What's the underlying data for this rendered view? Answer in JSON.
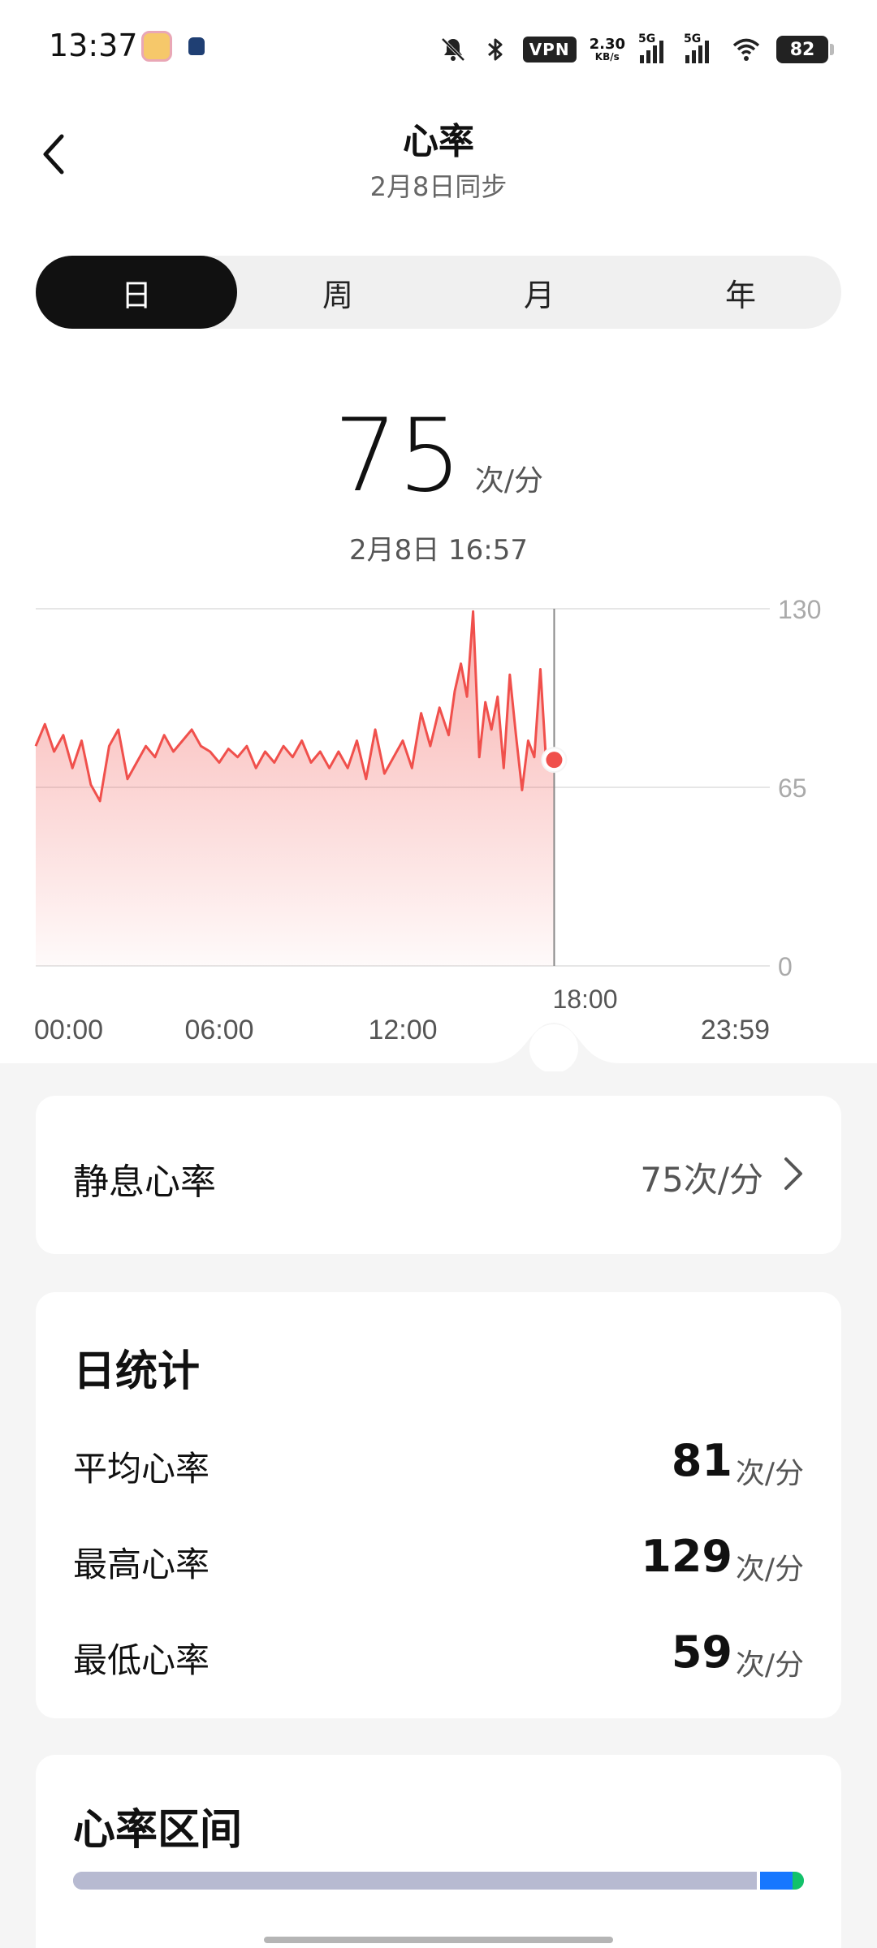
{
  "status_bar": {
    "time": "13:37",
    "net_speed_value": "2.30",
    "net_speed_unit": "KB/s",
    "vpn": "VPN",
    "sim1": "5G",
    "sim2": "5G",
    "battery": "82"
  },
  "header": {
    "title": "心率",
    "subtitle": "2月8日同步"
  },
  "tabs": [
    {
      "label": "日",
      "active": true
    },
    {
      "label": "周",
      "active": false
    },
    {
      "label": "月",
      "active": false
    },
    {
      "label": "年",
      "active": false
    }
  ],
  "current": {
    "value": "75",
    "unit": "次/分",
    "time": "2月8日 16:57"
  },
  "chart_data": {
    "type": "area",
    "ylim": [
      0,
      130
    ],
    "y_ticks": [
      "130",
      "65",
      "0"
    ],
    "x_ticks": [
      "00:00",
      "06:00",
      "12:00",
      "23:59"
    ],
    "cursor_label": "18:00",
    "cursor_time_hours": 16.95,
    "cursor_value": 75,
    "color": "#f0504c",
    "x_hours": [
      0,
      0.3,
      0.6,
      0.9,
      1.2,
      1.5,
      1.8,
      2.1,
      2.4,
      2.7,
      3.0,
      3.3,
      3.6,
      3.9,
      4.2,
      4.5,
      4.8,
      5.1,
      5.4,
      5.7,
      6.0,
      6.3,
      6.6,
      6.9,
      7.2,
      7.5,
      7.8,
      8.1,
      8.4,
      8.7,
      9.0,
      9.3,
      9.6,
      9.9,
      10.2,
      10.5,
      10.8,
      11.1,
      11.4,
      11.7,
      12.0,
      12.3,
      12.6,
      12.9,
      13.2,
      13.5,
      13.7,
      13.9,
      14.1,
      14.3,
      14.5,
      14.7,
      14.9,
      15.1,
      15.3,
      15.5,
      15.7,
      15.9,
      16.1,
      16.3,
      16.5,
      16.7,
      16.95
    ],
    "values": [
      80,
      88,
      78,
      84,
      72,
      82,
      66,
      60,
      80,
      86,
      68,
      74,
      80,
      76,
      84,
      78,
      82,
      86,
      80,
      78,
      74,
      79,
      76,
      80,
      72,
      78,
      74,
      80,
      76,
      82,
      74,
      78,
      72,
      78,
      72,
      82,
      68,
      86,
      70,
      76,
      82,
      72,
      92,
      80,
      94,
      84,
      100,
      110,
      98,
      129,
      76,
      96,
      86,
      98,
      72,
      106,
      84,
      64,
      82,
      76,
      108,
      72,
      75
    ]
  },
  "resting": {
    "label": "静息心率",
    "value": "75次/分"
  },
  "daily_stats": {
    "title": "日统计",
    "rows": [
      {
        "label": "平均心率",
        "value": "81",
        "unit": "次/分"
      },
      {
        "label": "最高心率",
        "value": "129",
        "unit": "次/分"
      },
      {
        "label": "最低心率",
        "value": "59",
        "unit": "次/分"
      }
    ]
  },
  "zones": {
    "title": "心率区间",
    "segments": [
      {
        "share": 0.936,
        "color": "#b7bad1"
      },
      {
        "share": 0.004,
        "color": "#ffffff"
      },
      {
        "share": 0.045,
        "color": "#1677ff"
      },
      {
        "share": 0.015,
        "color": "#12c26a"
      }
    ]
  }
}
